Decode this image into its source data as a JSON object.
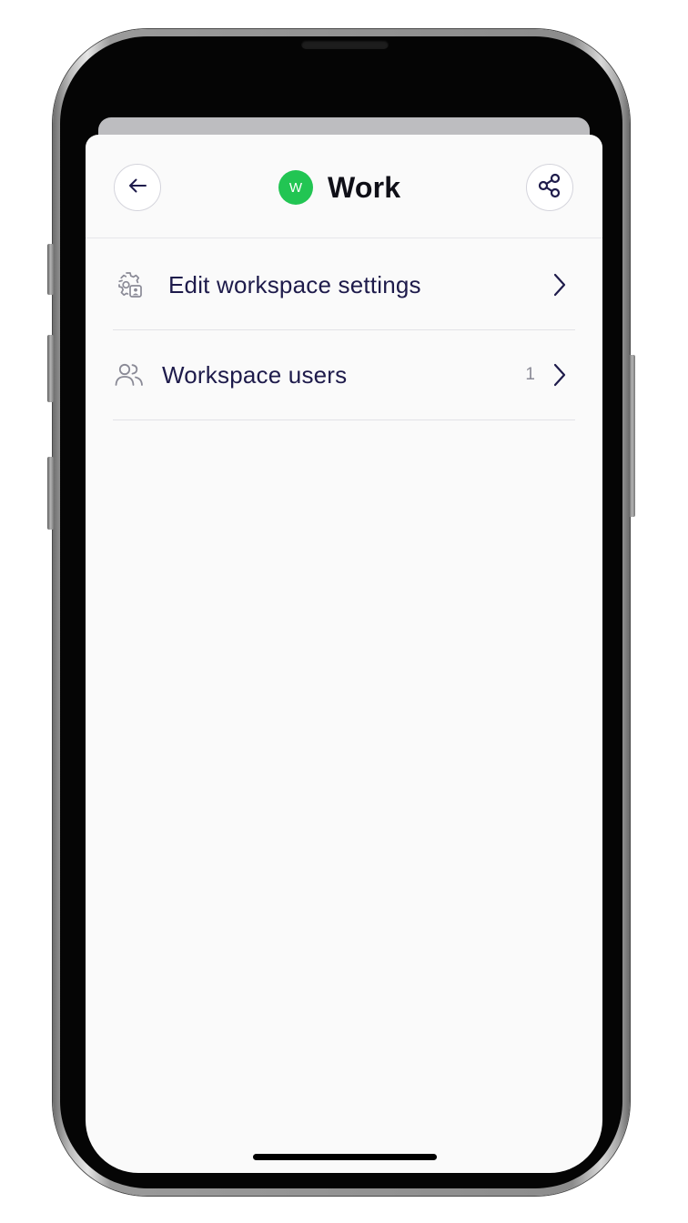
{
  "header": {
    "workspace_initial": "W",
    "title": "Work",
    "back_icon": "arrow-left-icon",
    "share_icon": "share-icon"
  },
  "menu": {
    "items": [
      {
        "label": "Edit workspace settings",
        "icon": "gear-settings-icon",
        "count": ""
      },
      {
        "label": "Workspace users",
        "icon": "users-icon",
        "count": "1"
      }
    ]
  },
  "colors": {
    "accent_green": "#22c553",
    "text_primary": "#1e1b4b",
    "title_text": "#0f0f17",
    "screen_background": "#fafafa"
  }
}
